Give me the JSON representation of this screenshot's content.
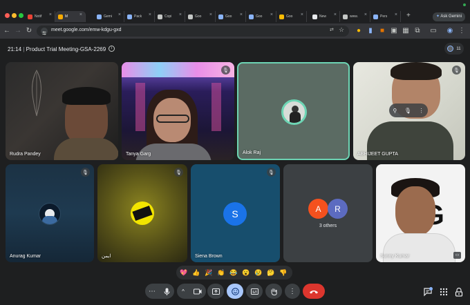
{
  "browser": {
    "tabs": [
      {
        "label": "Notif",
        "icon": "gmail-icon",
        "color": "#ea4335"
      },
      {
        "label": "M",
        "icon": "meet-icon",
        "color": "#f9ab00",
        "active": true
      },
      {
        "label": "Gemi",
        "icon": "gemini-icon",
        "color": "#8ab4f8"
      },
      {
        "label": "Pack",
        "icon": "gemini-icon",
        "color": "#8ab4f8"
      },
      {
        "label": "Copi",
        "icon": "copilot-icon",
        "color": "#c4c7c5"
      },
      {
        "label": "Goo",
        "icon": "globe-icon",
        "color": "#c4c7c5"
      },
      {
        "label": "Goo",
        "icon": "cube-icon",
        "color": "#8ab4f8"
      },
      {
        "label": "Goo",
        "icon": "cube-icon",
        "color": "#8ab4f8"
      },
      {
        "label": "Goo",
        "icon": "keep-icon",
        "color": "#fbbc04"
      },
      {
        "label": "New",
        "icon": "google-icon",
        "color": "#e8eaed"
      },
      {
        "label": "www.",
        "icon": "globe-icon",
        "color": "#c4c7c5"
      },
      {
        "label": "Pers",
        "icon": "gemini-icon",
        "color": "#8ab4f8"
      }
    ],
    "new_tab": "+",
    "ask_gemini": "Ask Gemini",
    "url": "meet.google.com/emw-kdgu-gxd"
  },
  "meeting": {
    "time": "21:14",
    "separator": "|",
    "title": "Product Trial Meeting-GSA-2269",
    "info_icon": "info-icon",
    "people_count": "11"
  },
  "tiles_top": [
    {
      "name": "Rudra Pandey",
      "muted": false
    },
    {
      "name": "Tanya Garg",
      "muted": true
    },
    {
      "name": "Alok Raj",
      "muted": false,
      "speaking": true
    },
    {
      "name": "ABHIJEET GUPTA",
      "muted": true
    }
  ],
  "tiles_bottom": [
    {
      "name": "Anurag Kumar",
      "muted": true
    },
    {
      "name": "ایمن",
      "muted": true
    },
    {
      "name": "Siena Brown",
      "muted": true,
      "initial": "S",
      "color": "#1a73e8"
    },
    {
      "name": "3 others",
      "initials": [
        "A",
        "R"
      ],
      "colors": [
        "#f4511e",
        "#5c6bc0"
      ]
    },
    {
      "name": "Sunny Kumar",
      "muted": false
    }
  ],
  "logo_text": "inG",
  "reactions": [
    "💖",
    "👍",
    "🎉",
    "👏",
    "😂",
    "😮",
    "😢",
    "🤔",
    "👎"
  ],
  "controls": {
    "more": "⋯",
    "mic": "mic-icon",
    "expand": "^",
    "camera": "camera-icon",
    "present": "present-icon",
    "reactions": "emoji-icon",
    "captions": "captions-icon",
    "hand": "raise-hand-icon",
    "options": "⋮",
    "leave": "end-call-icon",
    "chat": "chat-icon",
    "activities": "apps-icon",
    "host": "host-controls-icon"
  }
}
